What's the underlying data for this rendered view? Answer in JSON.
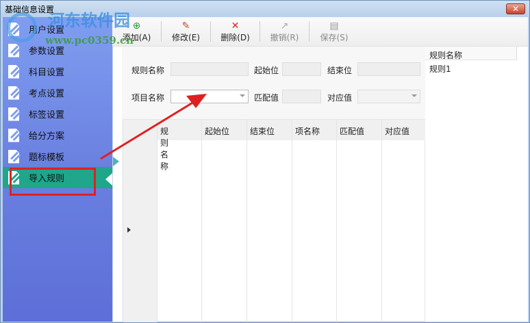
{
  "window": {
    "title": "基础信息设置",
    "close": "✕"
  },
  "watermark": {
    "text": "河东软件园",
    "url": "www.pc0359.cn"
  },
  "sidebar": {
    "items": [
      {
        "label": "用户设置"
      },
      {
        "label": "参数设置"
      },
      {
        "label": "科目设置"
      },
      {
        "label": "考点设置"
      },
      {
        "label": "标签设置"
      },
      {
        "label": "给分方案"
      },
      {
        "label": "题标模板"
      },
      {
        "label": "导入规则",
        "selected": true
      }
    ]
  },
  "toolbar": {
    "add": "添加(A)",
    "edit": "修改(E)",
    "delete": "删除(D)",
    "undo": "撤销(R)",
    "save": "保存(S)"
  },
  "form": {
    "rule_name": "规则名称",
    "start": "起始位",
    "end": "结束位",
    "item_name": "项目名称",
    "match": "匹配值",
    "mapped": "对应值"
  },
  "grid": {
    "columns": [
      "规则名称",
      "起始位",
      "结束位",
      "项名称",
      "匹配值",
      "对应值"
    ]
  },
  "rule_list": {
    "header": "规则名称",
    "items": [
      "规则1"
    ]
  },
  "colors": {
    "selected": "#1fa68b",
    "sidebar": "#7f9ef0",
    "annotation": "#e02020"
  }
}
